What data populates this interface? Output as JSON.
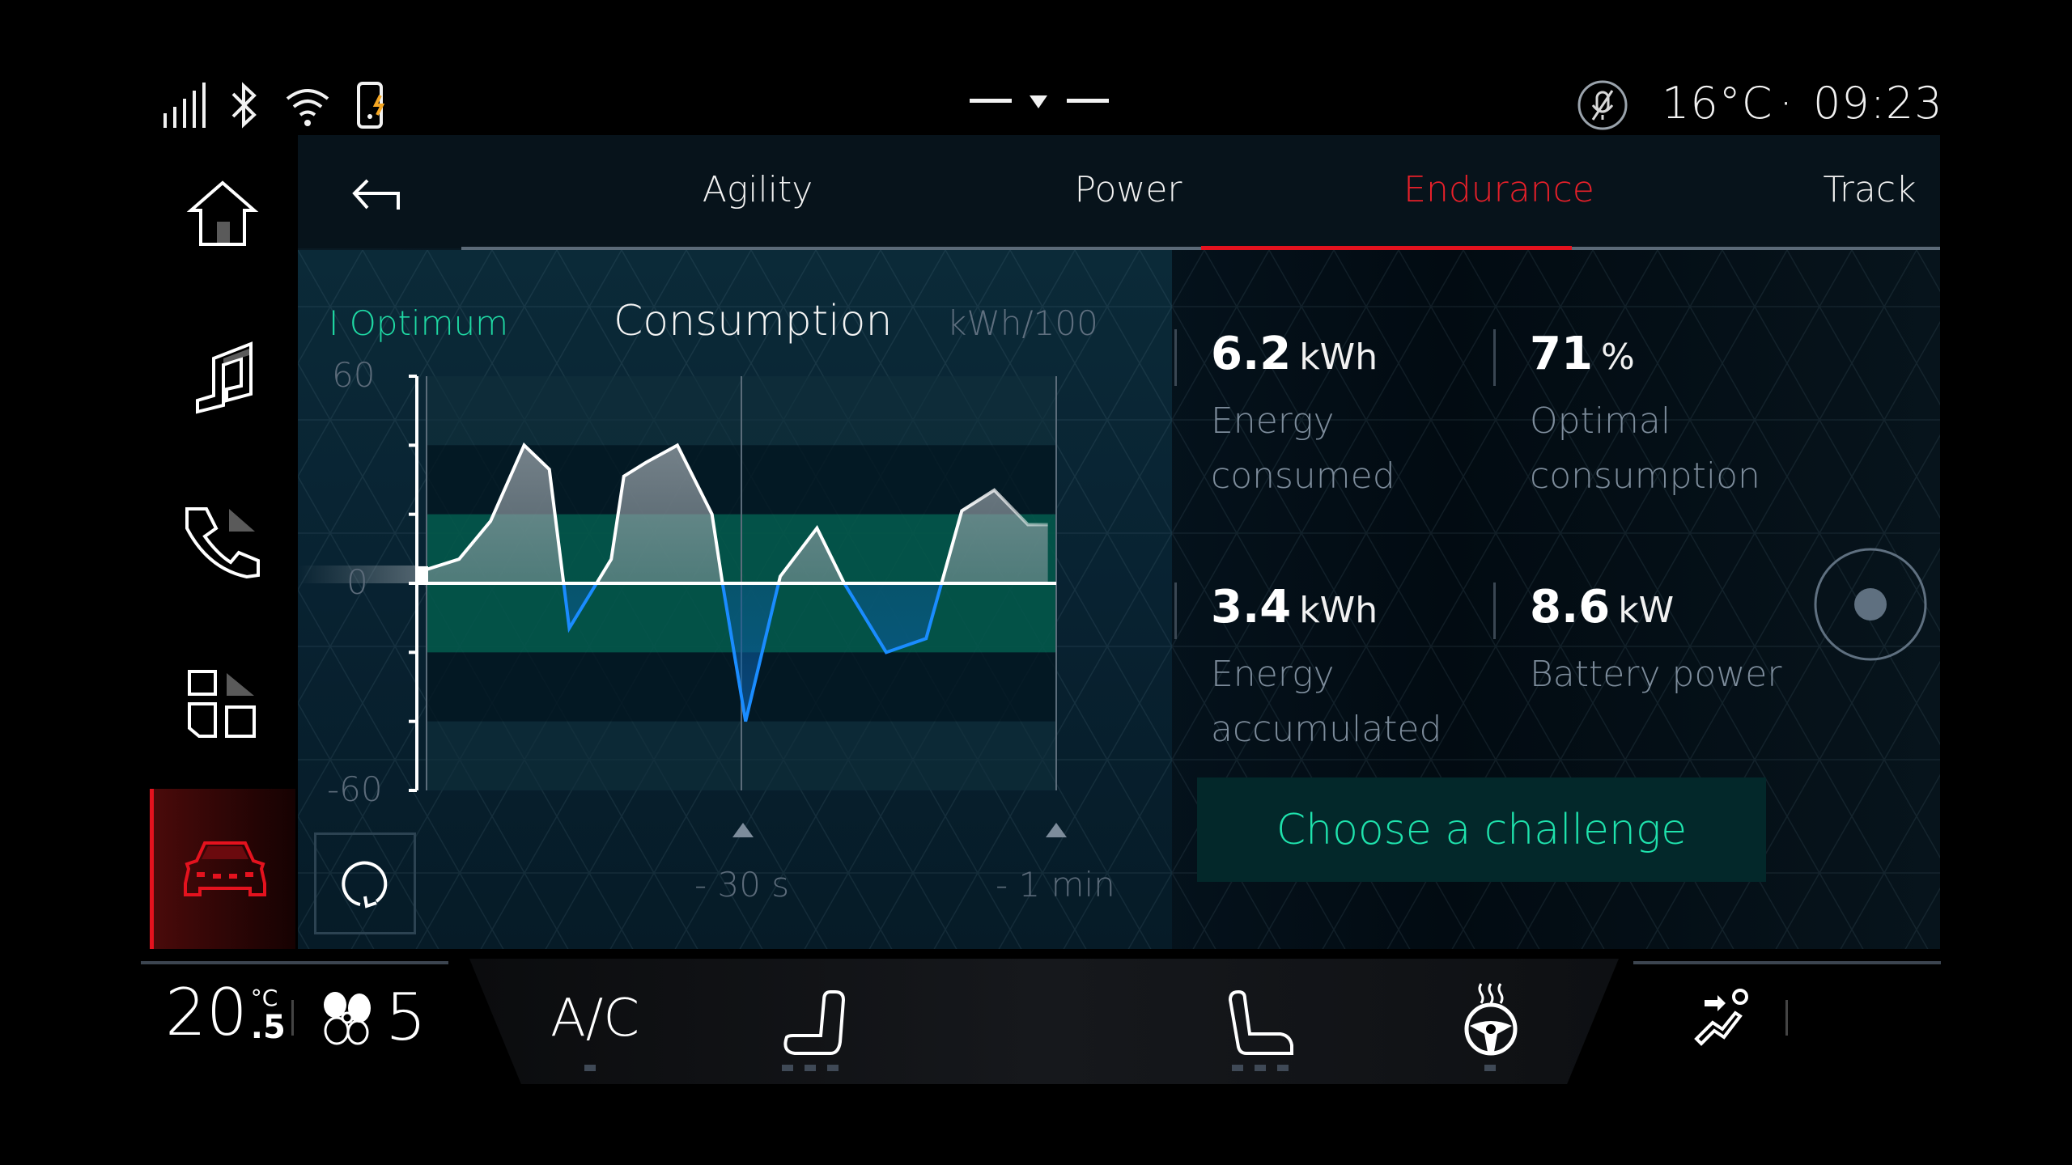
{
  "status_bar": {
    "icons": [
      "signal-icon",
      "bluetooth-icon",
      "wifi-icon",
      "phone-charging-icon"
    ],
    "handle": "drawer-handle",
    "mic_icon": "mic-muted-icon",
    "temperature": "16°C",
    "separator": "·",
    "time": "09:23"
  },
  "nav": {
    "items": [
      {
        "name": "home",
        "icon": "home-icon",
        "active": false
      },
      {
        "name": "music",
        "icon": "music-icon",
        "active": false
      },
      {
        "name": "phone",
        "icon": "phone-icon",
        "active": false
      },
      {
        "name": "apps",
        "icon": "apps-grid-icon",
        "active": false
      },
      {
        "name": "vehicle",
        "icon": "car-icon",
        "active": true
      }
    ]
  },
  "tabs": {
    "back_icon": "back-arrow-icon",
    "items": [
      {
        "label": "Agility",
        "active": false
      },
      {
        "label": "Power",
        "active": false
      },
      {
        "label": "Endurance",
        "active": true
      },
      {
        "label": "Track",
        "active": false
      }
    ]
  },
  "chart_header": {
    "optimum": "I Optimum",
    "title": "Consumption",
    "unit": "kWh/100"
  },
  "chart_data": {
    "type": "area",
    "title": "Consumption",
    "ylabel": "kWh/100",
    "ylim": [
      -60,
      60
    ],
    "yticks": [
      60,
      40,
      20,
      0,
      -20,
      -40,
      -60
    ],
    "ytick_labels": [
      "60",
      "0",
      "-60"
    ],
    "optimum_band": [
      -20,
      20
    ],
    "x_markers": [
      {
        "label": "- 30 s",
        "t": -30
      },
      {
        "label": "- 1 min",
        "t": -60
      }
    ],
    "x_range_seconds": [
      -60,
      0
    ],
    "series": [
      {
        "name": "consumption",
        "x": [
          0,
          3.1,
          6.1,
          9.3,
          11.7,
          13.6,
          17.6,
          18.8,
          20.9,
          23.9,
          27.2,
          28.2,
          30.4,
          33.7,
          37.2,
          39.8,
          43.8,
          47.6,
          51.0,
          54.1,
          57.3,
          59.2
        ],
        "values": [
          4,
          7,
          18,
          40,
          33,
          -13,
          7,
          31,
          35,
          40,
          20,
          0,
          -40,
          2,
          16,
          0,
          -20,
          -16,
          21,
          27,
          17,
          17
        ]
      }
    ],
    "colors": {
      "positive": "#ffffff",
      "negative": "#1a8cff",
      "band": "#03584a"
    }
  },
  "stats": [
    {
      "value": "6.2",
      "unit": "kWh",
      "label": [
        "Energy",
        "consumed"
      ]
    },
    {
      "value": "71",
      "unit": "%",
      "label": [
        "Optimal",
        "consumption"
      ]
    },
    {
      "value": "3.4",
      "unit": "kWh",
      "label": [
        "Energy",
        "accumulated"
      ]
    },
    {
      "value": "8.6",
      "unit": "kW",
      "label": [
        "Battery power"
      ]
    }
  ],
  "reset_icon": "reset-icon",
  "dial_icon": "rotary-dial-icon",
  "cta": {
    "label": "Choose a challenge"
  },
  "climate": {
    "temp_main": "20",
    "temp_unit": "°C",
    "temp_decimal": ".5",
    "fan_level": "5",
    "ac_label": "A/C",
    "ac_level": 1,
    "seat_heat_level": 3,
    "seat_vent_level": 3,
    "wheel_heat_level": 1
  },
  "colors": {
    "accent_red": "#e4121e",
    "accent_green": "#1fe3ad",
    "negative_blue": "#1a8cff"
  }
}
